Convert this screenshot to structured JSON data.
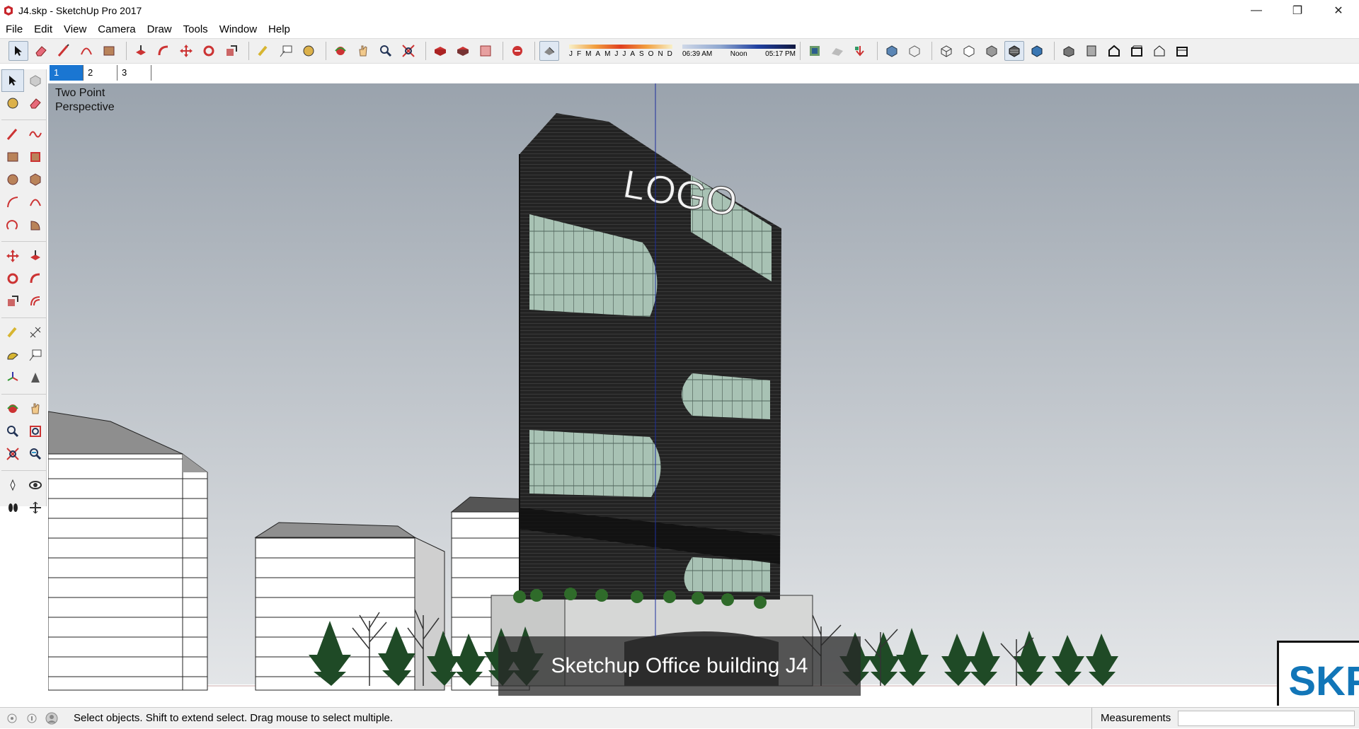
{
  "window": {
    "title": "J4.skp - SketchUp Pro 2017"
  },
  "menu": [
    "File",
    "Edit",
    "View",
    "Camera",
    "Draw",
    "Tools",
    "Window",
    "Help"
  ],
  "shadows": {
    "months": [
      "J",
      "F",
      "M",
      "A",
      "M",
      "J",
      "J",
      "A",
      "S",
      "O",
      "N",
      "D"
    ],
    "time_start": "06:39 AM",
    "time_noon": "Noon",
    "time_end": "05:17 PM"
  },
  "scenes": [
    "1",
    "2",
    "3"
  ],
  "viewport": {
    "camera_label": "Two Point\nPerspective",
    "building_logo_text": "LOGO",
    "caption": "Sketchup Office building J4",
    "brand_badge": "SKP"
  },
  "status": {
    "hint": "Select objects. Shift to extend select. Drag mouse to select multiple.",
    "measurements_label": "Measurements",
    "measurements_value": ""
  },
  "colors": {
    "accent": "#1a76d2",
    "sky_top": "#9aa3ad",
    "sky_bottom": "#e6e8ea",
    "ground": "#ffffff"
  }
}
